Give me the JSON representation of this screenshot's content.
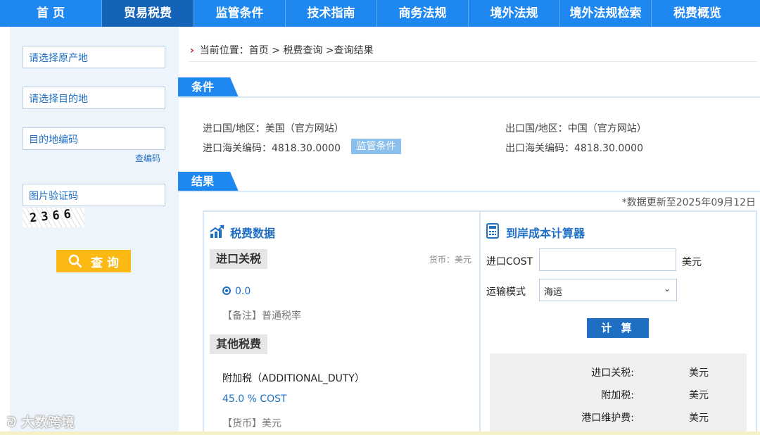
{
  "nav": {
    "items": [
      "首 页",
      "贸易税费",
      "监管条件",
      "技术指南",
      "商务法规",
      "境外法规",
      "境外法规检索",
      "税费概览"
    ],
    "active_index": 1
  },
  "sidebar": {
    "origin_placeholder": "请选择原产地",
    "destination_placeholder": "请选择目的地",
    "dest_code_placeholder": "目的地编码",
    "lookup_code_link": "查编码",
    "captcha_placeholder": "图片验证码",
    "captcha_text": "2366",
    "query_button": "查 询"
  },
  "breadcrumb": "当前位置：首页 > 税费查询 >查询结果",
  "conditions": {
    "title": "条件",
    "import_country": "进口国/地区：美国（官方网站）",
    "import_code": "进口海关编码：4818.30.0000",
    "regulation_button": "监管条件",
    "export_country": "出口国/地区：中国（官方网站）",
    "export_code": "出口海关编码：4818.30.0000"
  },
  "results": {
    "title": "结果",
    "update_note": "*数据更新至2025年09月12日",
    "tax_data": {
      "title": "税费数据",
      "import_duty_tab": "进口关税",
      "currency": "货币：美元",
      "duty_rate": "0.0",
      "note": "【备注】普通税率",
      "other_tab": "其他税费",
      "additional_name": "附加税（ADDITIONAL_DUTY）",
      "additional_rate": "45.0 % COST",
      "additional_currency": "【货币】美元"
    },
    "calculator": {
      "title": "到岸成本计算器",
      "cost_label": "进口COST",
      "cost_unit": "美元",
      "transport_label": "运输模式",
      "transport_value": "海运",
      "calc_button": "计 算",
      "rows": [
        {
          "label": "进口关税:",
          "unit": "美元"
        },
        {
          "label": "附加税:",
          "unit": "美元"
        },
        {
          "label": "港口维护费:",
          "unit": "美元"
        }
      ]
    }
  },
  "watermark": "大数跨境",
  "colors": {
    "nav": "#1e88f0",
    "nav_active": "#1463b9",
    "accent": "#1e6fc4",
    "query_button": "#fcb813"
  }
}
